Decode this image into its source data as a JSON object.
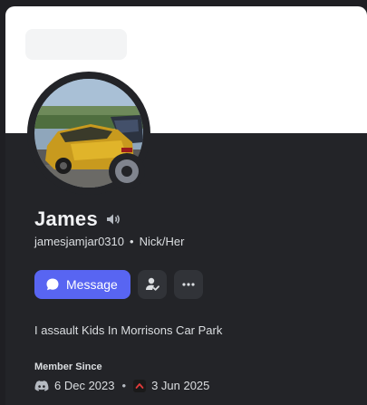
{
  "profile": {
    "display_name": "James",
    "username": "jamesjamjar0310",
    "separator": "•",
    "pronouns": "Nick/Her",
    "bio": "I assault Kids In Morrisons Car Park",
    "status": "offline"
  },
  "actions": {
    "message_label": "Message"
  },
  "member_since": {
    "label": "Member Since",
    "discord_date": "6 Dec 2023",
    "separator": "•",
    "server_date": "3 Jun 2025"
  },
  "colors": {
    "accent": "#5865f2",
    "status_offline": "#80848e",
    "banner": "#ffffff",
    "card_bg": "#232428"
  }
}
